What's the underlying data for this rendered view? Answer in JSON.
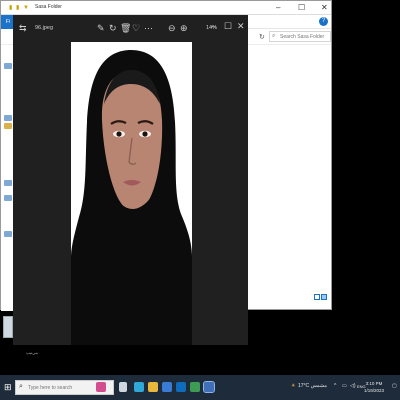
{
  "explorer": {
    "title": "Sasa Folder",
    "file_tab": "Fi",
    "search_placeholder": "Search Sasa Folder",
    "file_name_label": "يني‌تيپ"
  },
  "viewer": {
    "file_name": "96.jpeg",
    "zoom": "14%"
  },
  "taskbar": {
    "search_placeholder": "Type here to search",
    "weather": "17°C  مشمس",
    "language": "ENG",
    "time": "3:10 PM",
    "date": "1/19/2023"
  },
  "colors": {
    "viewer_bg": "#202020",
    "taskbar_bg": "#1e2b3a",
    "accent": "#1a73c9"
  }
}
